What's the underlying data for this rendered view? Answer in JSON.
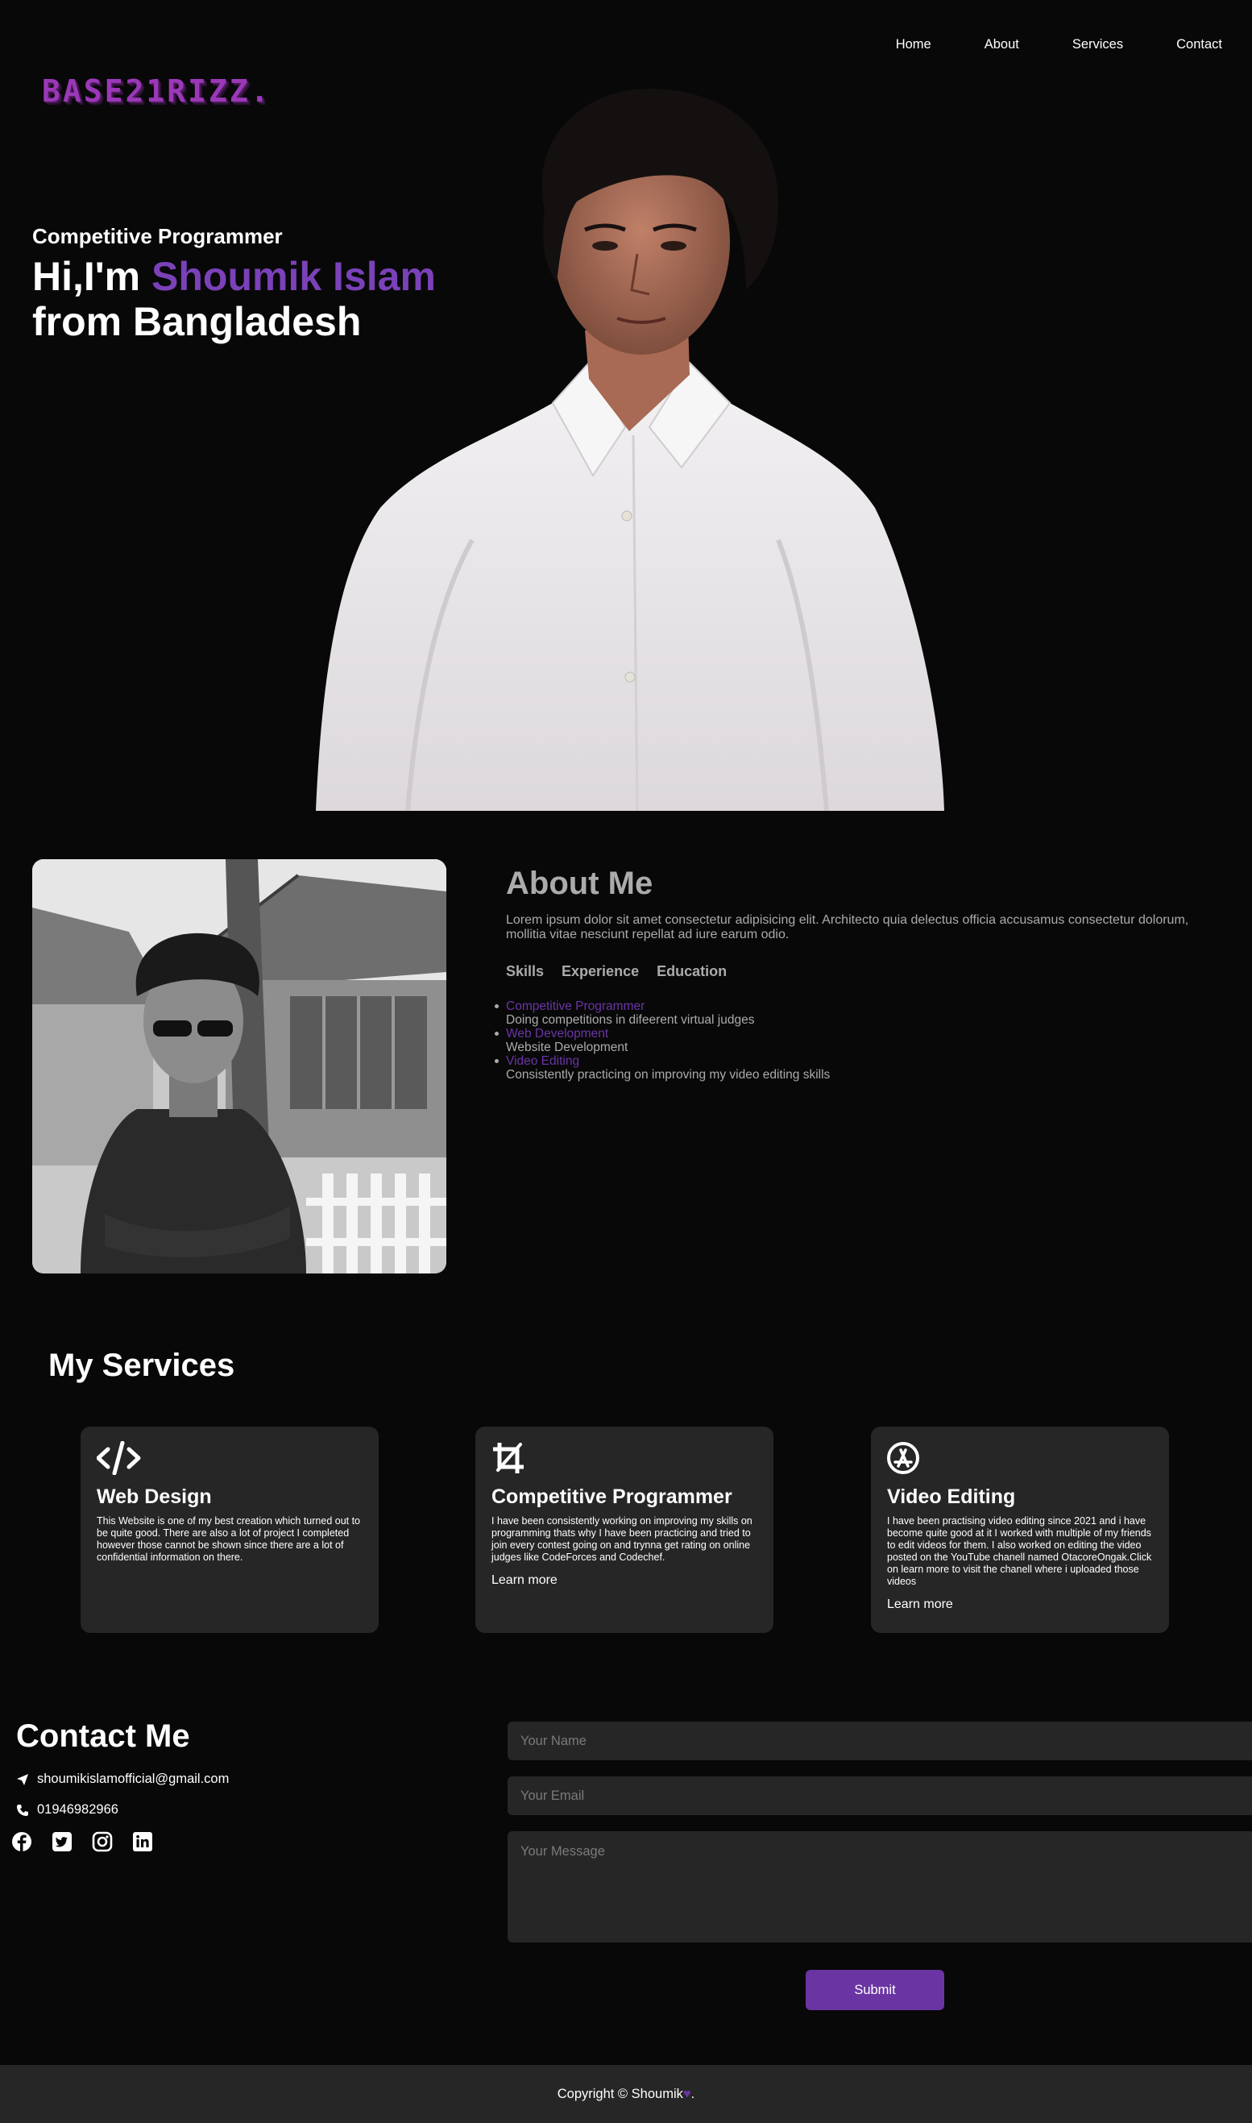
{
  "header": {
    "logo": "BASE21RIZZ.",
    "nav": [
      "Home",
      "About",
      "Services",
      "Contact"
    ]
  },
  "hero": {
    "subtitle": "Competitive Programmer",
    "greeting": "Hi,I'm ",
    "name": "Shoumik Islam",
    "line2": "from Bangladesh"
  },
  "about": {
    "title": "About Me",
    "text": "Lorem ipsum dolor sit amet consectetur adipisicing elit. Architecto quia delectus officia accusamus consectetur dolorum, mollitia vitae nesciunt repellat ad iure earum odio.",
    "tabs": [
      "Skills",
      "Experience",
      "Education"
    ],
    "skills": [
      {
        "title": "Competitive Programmer",
        "desc": "Doing competitions in difeerent virtual judges"
      },
      {
        "title": "Web Development",
        "desc": "Website Development"
      },
      {
        "title": "Video Editing",
        "desc": "Consistently practicing on improving my video editing skills"
      }
    ]
  },
  "services": {
    "title": "My Services",
    "cards": [
      {
        "icon": "code-icon",
        "title": "Web Design",
        "text": "This Website is one of my best creation which turned out to be quite good. There are also a lot of project I completed however those cannot be shown since there are a lot of confidential information on there.",
        "more": ""
      },
      {
        "icon": "crop-icon",
        "title": "Competitive Programmer",
        "text": "I have been consistently working on improving my skills on programming thats why I have been practicing and tried to join every contest going on and trynna get rating on online judges like CodeForces and Codechef.",
        "more": "Learn more"
      },
      {
        "icon": "app-store-icon",
        "title": "Video Editing",
        "text": "I have been practising video editing since 2021 and i have become quite good at it I worked with multiple of my friends to edit videos for them. I also worked on editing the video posted on the YouTube chanell named OtacoreOngak.Click on learn more to visit the chanell where i uploaded those videos",
        "more": "Learn more"
      }
    ]
  },
  "contact": {
    "title": "Contact Me",
    "email": "shoumikislamofficial@gmail.com",
    "phone": "01946982966",
    "socials": [
      "facebook-icon",
      "twitter-icon",
      "instagram-icon",
      "linkedin-icon"
    ],
    "name_placeholder": "Your Name",
    "email_placeholder": "Your Email",
    "message_placeholder": "Your Message",
    "submit": "Submit"
  },
  "footer": {
    "copyright": "Copyright © Shoumik",
    "heart": "♥",
    "suffix": "."
  },
  "colors": {
    "background": "#080808",
    "accent": "#6a35a3",
    "card": "#262626",
    "muted_text": "#ababab"
  }
}
